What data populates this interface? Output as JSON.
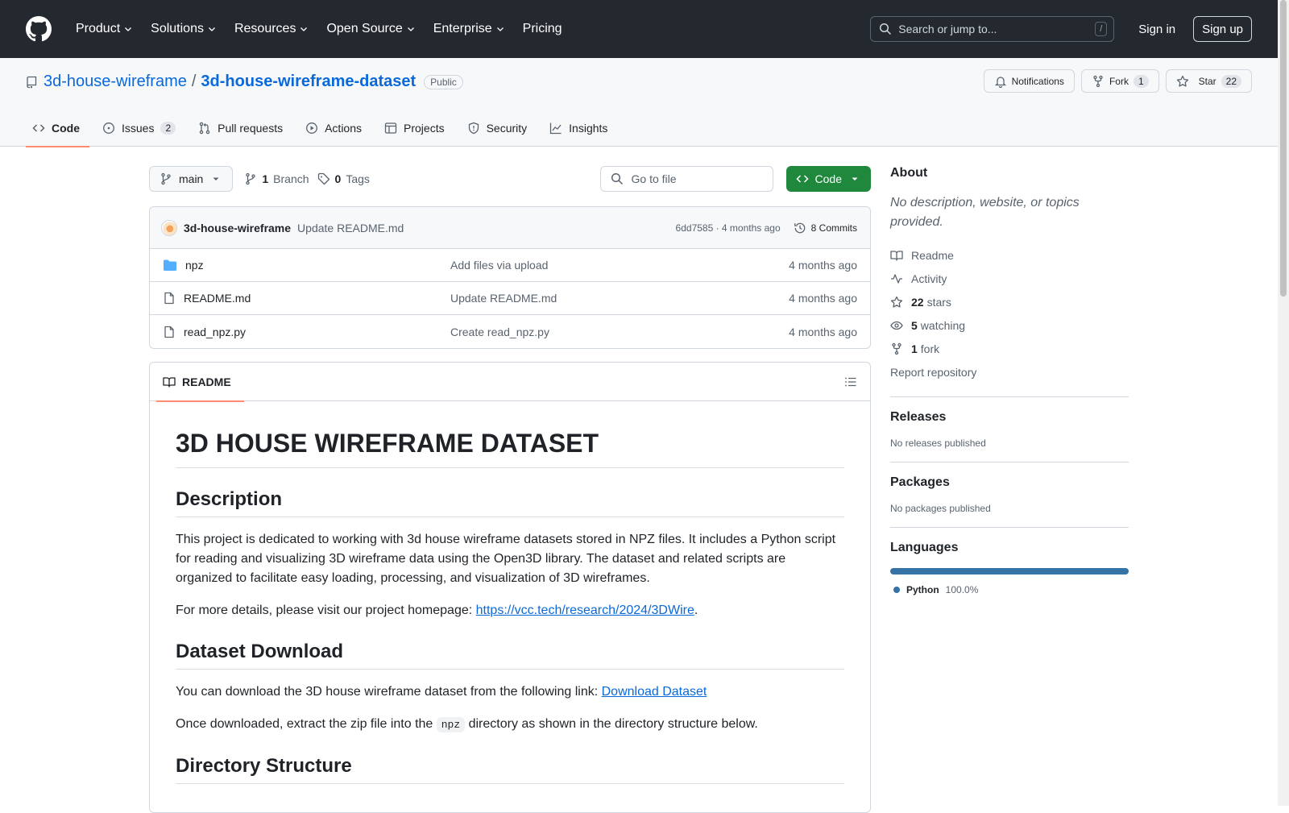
{
  "header": {
    "nav": [
      "Product",
      "Solutions",
      "Resources",
      "Open Source",
      "Enterprise",
      "Pricing"
    ],
    "search_placeholder": "Search or jump to...",
    "search_shortcut": "/",
    "signin": "Sign in",
    "signup": "Sign up"
  },
  "repo": {
    "owner": "3d-house-wireframe",
    "separator": "/",
    "name": "3d-house-wireframe-dataset",
    "visibility": "Public",
    "notifications_label": "Notifications",
    "fork_label": "Fork",
    "fork_count": "1",
    "star_label": "Star",
    "star_count": "22",
    "tabs": [
      {
        "label": "Code",
        "count": ""
      },
      {
        "label": "Issues",
        "count": "2"
      },
      {
        "label": "Pull requests",
        "count": ""
      },
      {
        "label": "Actions",
        "count": ""
      },
      {
        "label": "Projects",
        "count": ""
      },
      {
        "label": "Security",
        "count": ""
      },
      {
        "label": "Insights",
        "count": ""
      }
    ]
  },
  "branch_bar": {
    "branch": "main",
    "branch_count": "1",
    "branch_word": "Branch",
    "tag_count": "0",
    "tag_word": "Tags",
    "goto_placeholder": "Go to file",
    "code_button": "Code"
  },
  "commit": {
    "author": "3d-house-wireframe",
    "message": "Update README.md",
    "hash_age": "6dd7585 · 4 months ago",
    "commits_label": "8 Commits"
  },
  "files": [
    {
      "name": "npz",
      "commit": "Add files via upload",
      "age": "4 months ago",
      "type": "folder"
    },
    {
      "name": "README.md",
      "commit": "Update README.md",
      "age": "4 months ago",
      "type": "file"
    },
    {
      "name": "read_npz.py",
      "commit": "Create read_npz.py",
      "age": "4 months ago",
      "type": "file"
    }
  ],
  "readme": {
    "tab_label": "README",
    "h1": "3D HOUSE WIREFRAME DATASET",
    "h2_description": "Description",
    "p_description": "This project is dedicated to working with 3d house wireframe datasets stored in NPZ files. It includes a Python script for reading and visualizing 3D wireframe data using the Open3D library. The dataset and related scripts are organized to facilitate easy loading, processing, and visualization of 3D wireframes.",
    "p_details_prefix": "For more details, please visit our project homepage: ",
    "homepage_link": "https://vcc.tech/research/2024/3DWire",
    "p_details_suffix": ".",
    "h2_download": "Dataset Download",
    "p_download_prefix": "You can download the 3D house wireframe dataset from the following link: ",
    "download_link": "Download Dataset",
    "p_extract_prefix": "Once downloaded, extract the zip file into the ",
    "p_extract_code": "npz",
    "p_extract_suffix": " directory as shown in the directory structure below.",
    "h2_structure": "Directory Structure"
  },
  "sidebar": {
    "about_title": "About",
    "about_desc": "No description, website, or topics provided.",
    "readme": "Readme",
    "activity": "Activity",
    "stars_count": "22",
    "stars_word": "stars",
    "watching_count": "5",
    "watching_word": "watching",
    "fork_count": "1",
    "fork_word": "fork",
    "report": "Report repository",
    "releases_title": "Releases",
    "releases_empty": "No releases published",
    "packages_title": "Packages",
    "packages_empty": "No packages published",
    "languages_title": "Languages",
    "language_name": "Python",
    "language_pct": "100.0%",
    "language_color": "#3572a5",
    "language_fraction": 1.0
  }
}
